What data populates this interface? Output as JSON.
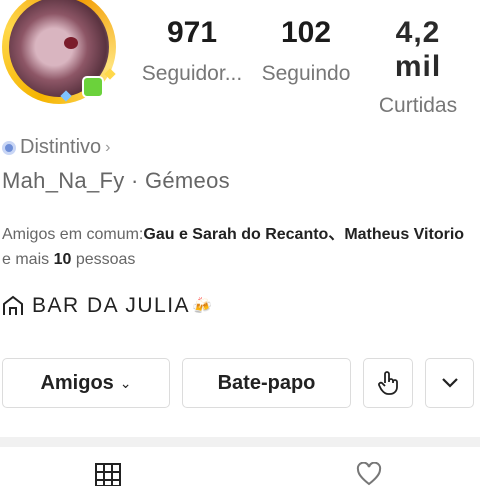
{
  "stats": {
    "followers_value": "971",
    "followers_label": "Seguidor...",
    "following_value": "102",
    "following_label": "Seguindo",
    "likes_value": "4,2 mil",
    "likes_label": "Curtidas"
  },
  "profile": {
    "badge_label": "Distintivo",
    "badge_chevron": "›",
    "username_line": "Mah_Na_Fy · Gémeos",
    "bio_line": "BAR DA JULIA",
    "bio_emoji": "🍻"
  },
  "mutual_friends": {
    "prefix": "Amigos em comum:",
    "names": "Gau e Sarah do Recanto、Matheus Vitorio",
    "middle": " e mais ",
    "count": "10",
    "suffix": " pessoas"
  },
  "actions": {
    "friends_label": "Amigos",
    "friends_caret": "⌄",
    "chat_label": "Bate-papo"
  },
  "icons": {
    "badge": "gem-icon",
    "bio": "house-icon",
    "gesture": "pointing-hand-icon",
    "more": "chevron-down-icon",
    "grid_tab": "grid-icon",
    "liked_tab": "heart-icon"
  },
  "colors": {
    "avatar_ring": "#f5b400",
    "muted_text": "#777777",
    "badge_gem": "#6f8fd8"
  }
}
